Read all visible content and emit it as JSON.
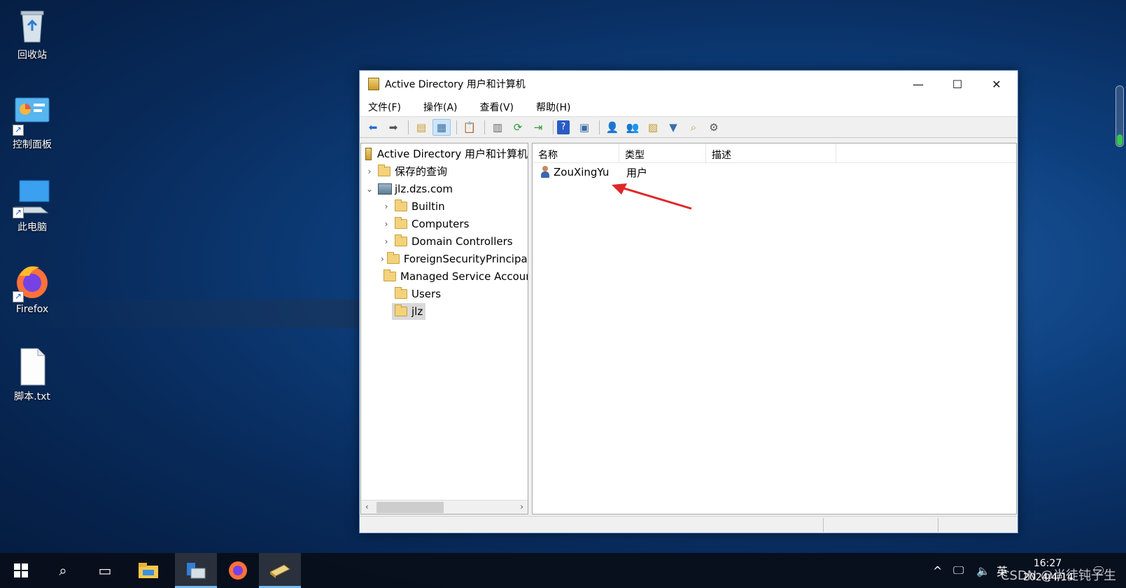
{
  "desktop": {
    "icons": [
      {
        "label": "回收站",
        "icon": "recycle-bin-icon"
      },
      {
        "label": "控制面板",
        "icon": "control-panel-icon"
      },
      {
        "label": "此电脑",
        "icon": "this-pc-icon"
      },
      {
        "label": "Firefox",
        "icon": "firefox-icon"
      },
      {
        "label": "脚本.txt",
        "icon": "text-file-icon"
      }
    ]
  },
  "window": {
    "title": "Active Directory 用户和计算机",
    "controls": {
      "minimize": "—",
      "maximize": "☐",
      "close": "✕"
    },
    "menu": [
      "文件(F)",
      "操作(A)",
      "查看(V)",
      "帮助(H)"
    ],
    "toolbar_icons": [
      "back-icon",
      "forward-icon",
      "up-folder-icon",
      "show-hide-tree-icon",
      "clipboard-icon",
      "properties-icon",
      "refresh-icon",
      "export-list-icon",
      "help-icon",
      "console-icon",
      "new-user-icon",
      "new-group-icon",
      "new-ou-icon",
      "filter-icon",
      "find-icon",
      "delegate-icon"
    ],
    "tree": {
      "root": "Active Directory 用户和计算机",
      "saved_queries": "保存的查询",
      "domain": "jlz.dzs.com",
      "children": [
        "Builtin",
        "Computers",
        "Domain Controllers",
        "ForeignSecurityPrincipals",
        "Managed Service Accounts",
        "Users",
        "jlz"
      ],
      "selected": "jlz"
    },
    "list": {
      "columns": [
        "名称",
        "类型",
        "描述"
      ],
      "rows": [
        {
          "name": "ZouXingYu",
          "type": "用户",
          "description": ""
        }
      ]
    }
  },
  "taskbar": {
    "apps": [
      "start-icon",
      "search-icon",
      "task-view-icon",
      "file-explorer-icon",
      "server-manager-icon",
      "firefox-icon",
      "ad-users-computers-icon"
    ],
    "tray": {
      "ime": "英",
      "time": "16:27",
      "date": "2024/4/14"
    }
  },
  "watermark": "CSDN @尚徒钝子生"
}
